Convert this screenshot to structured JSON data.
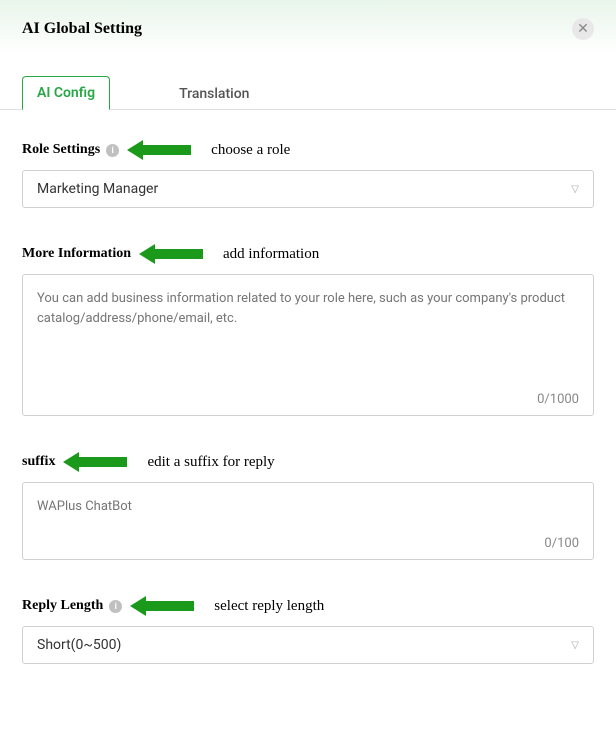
{
  "header": {
    "title": "AI Global Setting"
  },
  "tabs": {
    "ai_config": "AI Config",
    "translation": "Translation"
  },
  "role_settings": {
    "label": "Role Settings",
    "annotation": "choose a role",
    "value": "Marketing Manager"
  },
  "more_information": {
    "label": "More Information",
    "annotation": "add information",
    "placeholder": "You can add business information related to your role here, such as your company's product catalog/address/phone/email, etc.",
    "counter": "0/1000"
  },
  "suffix": {
    "label": "suffix",
    "annotation": "edit a suffix for reply",
    "placeholder": "WAPlus ChatBot",
    "counter": "0/100"
  },
  "reply_length": {
    "label": "Reply Length",
    "annotation": "select reply length",
    "value": "Short(0~500)"
  }
}
